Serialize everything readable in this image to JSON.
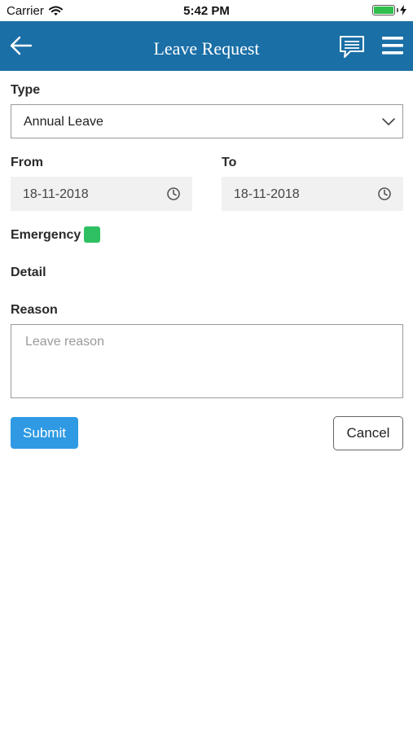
{
  "status_bar": {
    "carrier": "Carrier",
    "time": "5:42 PM",
    "battery_level": 1.0,
    "icons": [
      "wifi-icon",
      "battery-icon",
      "charging-icon"
    ]
  },
  "header": {
    "title": "Leave Request",
    "background_color": "#1a6fa6",
    "icons": [
      "back-arrow-icon",
      "chat-icon",
      "menu-icon"
    ]
  },
  "form": {
    "type": {
      "label": "Type",
      "selected": "Annual Leave"
    },
    "from": {
      "label": "From",
      "value": "18-11-2018"
    },
    "to": {
      "label": "To",
      "value": "18-11-2018"
    },
    "emergency": {
      "label": "Emergency",
      "checked": true,
      "color": "#2ec061"
    },
    "detail": {
      "label": "Detail"
    },
    "reason": {
      "label": "Reason",
      "placeholder": "Leave reason",
      "value": ""
    }
  },
  "actions": {
    "submit_label": "Submit",
    "submit_color": "#2f9ae3",
    "cancel_label": "Cancel"
  }
}
